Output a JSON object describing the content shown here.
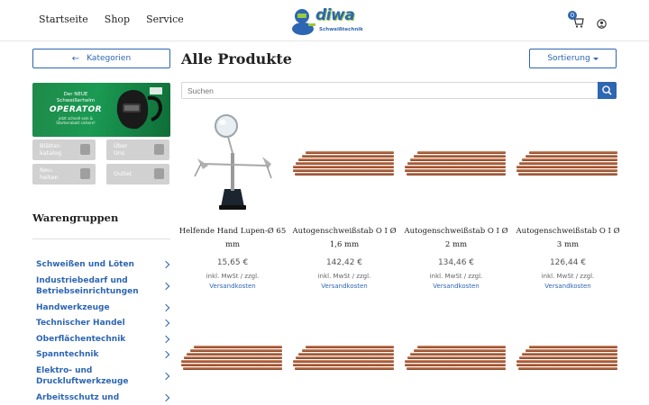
{
  "header": {
    "nav": [
      "Startseite",
      "Shop",
      "Service"
    ],
    "logo_text": "diwa",
    "logo_subtext": "Schweißtechnik",
    "cart_count": "0"
  },
  "sidebar": {
    "kategorien_label": "Kategorien",
    "banner": {
      "line1": "Der NEUE Schweißerhelm",
      "line2": "OPERATOR",
      "line3": "jetzt schnell sein & Starterrabatt sichern!"
    },
    "tiles": [
      {
        "label": "Blätter-\nkatalog"
      },
      {
        "label": "Über\nUns"
      },
      {
        "label": "Neu-\nheiten"
      },
      {
        "label": "Outlet"
      }
    ],
    "warengruppen_title": "Warengruppen",
    "categories": [
      "Schweißen und Löten",
      "Industriebedarf und Betriebseinrichtungen",
      "Handwerkzeuge",
      "Technischer Handel",
      "Oberflächentechnik",
      "Spanntechnik",
      "Elektro- und Druckluftwerkzeuge",
      "Arbeitsschutz und"
    ]
  },
  "main": {
    "title": "Alle Produkte",
    "sort_label": "Sortierung",
    "search_placeholder": "Suchen",
    "products": [
      {
        "name": "Helfende Hand Lupen-Ø 65 mm",
        "price": "15,65 €",
        "tax": "inkl. MwSt / zzgl.",
        "shipping": "Versandkosten",
        "image": "helping-hand"
      },
      {
        "name": "Autogenschweißstab O I Ø 1,6 mm",
        "price": "142,42 €",
        "tax": "inkl. MwSt / zzgl.",
        "shipping": "Versandkosten",
        "image": "copper-rods"
      },
      {
        "name": "Autogenschweißstab O I Ø 2 mm",
        "price": "134,46 €",
        "tax": "inkl. MwSt / zzgl.",
        "shipping": "Versandkosten",
        "image": "copper-rods"
      },
      {
        "name": "Autogenschweißstab O I Ø 3 mm",
        "price": "126,44 €",
        "tax": "inkl. MwSt / zzgl.",
        "shipping": "Versandkosten",
        "image": "copper-rods"
      }
    ],
    "row2_images": [
      "copper-rods",
      "copper-rods",
      "copper-rods",
      "copper-rods"
    ]
  },
  "colors": {
    "accent": "#2d66b2",
    "banner_green": "#1a9a52"
  }
}
